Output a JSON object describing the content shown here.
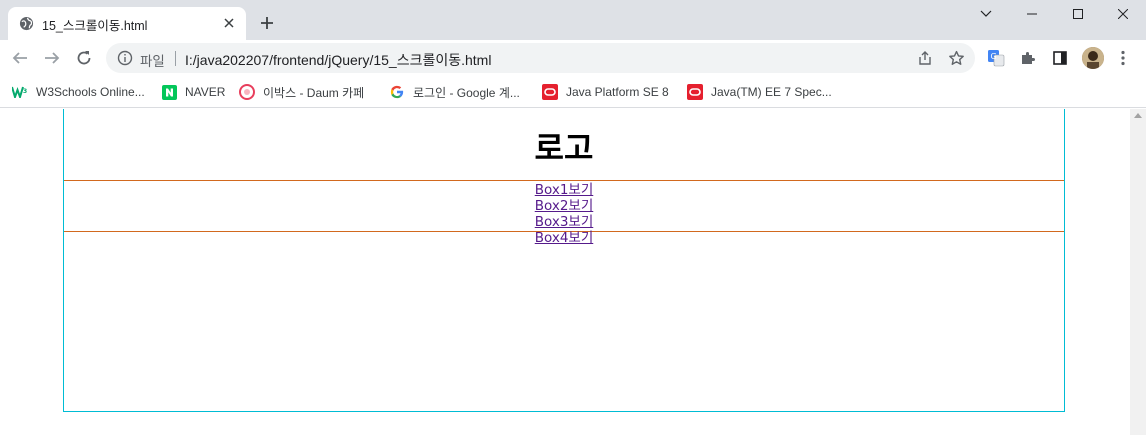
{
  "browser": {
    "tab": {
      "title": "15_스크롤이동.html"
    },
    "address": {
      "scheme_label": "파일",
      "url": "I:/java202207/frontend/jQuery/15_스크롤이동.html"
    },
    "bookmarks": [
      {
        "label": "W3Schools Online...",
        "icon": "w3schools-icon"
      },
      {
        "label": "NAVER",
        "icon": "naver-icon"
      },
      {
        "label": "이박스 - Daum 카페",
        "icon": "daum-cafe-icon"
      },
      {
        "label": "로그인 - Google 계...",
        "icon": "google-icon"
      },
      {
        "label": "Java Platform SE 8",
        "icon": "oracle-icon"
      },
      {
        "label": "Java(TM) EE 7 Spec...",
        "icon": "oracle-icon"
      }
    ]
  },
  "page": {
    "logo": "로고",
    "menu": [
      {
        "label": "Box1보기"
      },
      {
        "label": "Box2보기"
      },
      {
        "label": "Box3보기"
      },
      {
        "label": "Box4보기"
      }
    ]
  },
  "colors": {
    "container_border": "#00bcd4",
    "section_border": "#d2691e",
    "link": "#551a8b"
  }
}
